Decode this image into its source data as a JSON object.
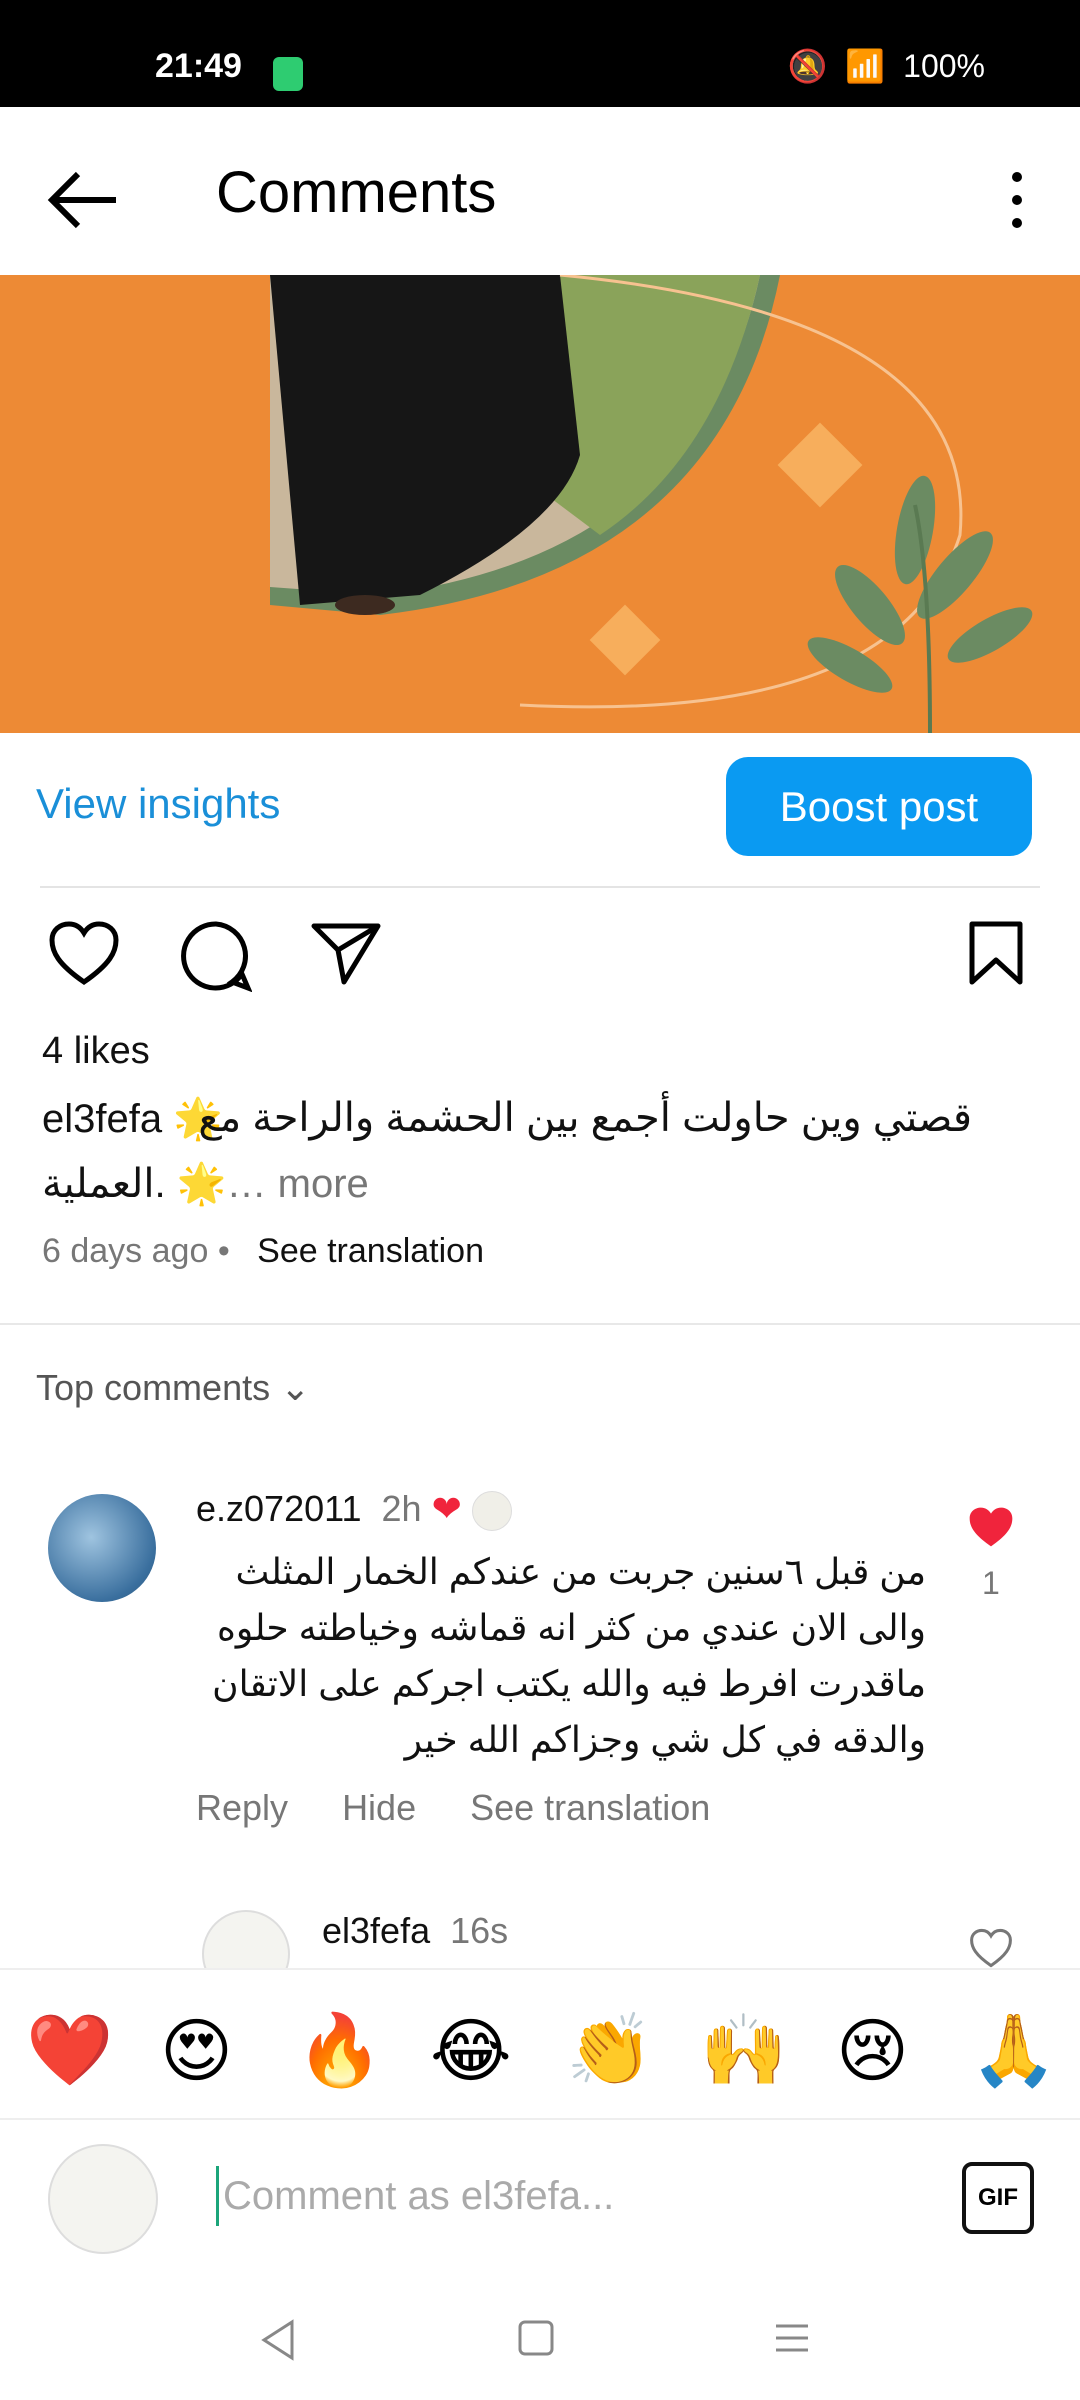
{
  "status": {
    "time": "21:49",
    "battery": "100%"
  },
  "header": {
    "title": "Comments"
  },
  "post": {
    "insights_label": "View insights",
    "boost_label": "Boost post",
    "likes": "4 likes",
    "username": "el3fefa",
    "caption_line1": "قصتي وين حاولت أجمع بين الحشمة والراحة مع",
    "caption_line2": "العملية.",
    "more_label": "… more",
    "time_ago": "6 days ago",
    "see_translation": "See translation"
  },
  "comments_header": "Top comments",
  "comment": {
    "username": "e.z072011",
    "time": "2h",
    "text": "من قبل ٦سنين جربت من عندكم الخمار المثلث والى الان عندي من كثر انه قماشه وخياطته حلوه ماقدرت افرط فيه والله يكتب اجركم على الاتقان والدقه في كل شي وجزاكم الله خير",
    "reply_label": "Reply",
    "hide_label": "Hide",
    "translate_label": "See translation",
    "like_count": "1"
  },
  "reply": {
    "username": "el3fefa",
    "time": "16s"
  },
  "emojis": [
    "❤️",
    "😍",
    "🔥",
    "😂",
    "👏",
    "🙌",
    "😢",
    "🙏"
  ],
  "input": {
    "placeholder": "Comment as el3fefa...",
    "gif_label": "GIF"
  },
  "colors": {
    "accent": "#0a9af2",
    "banner": "#ed8a35",
    "heart": "#f0243c"
  }
}
